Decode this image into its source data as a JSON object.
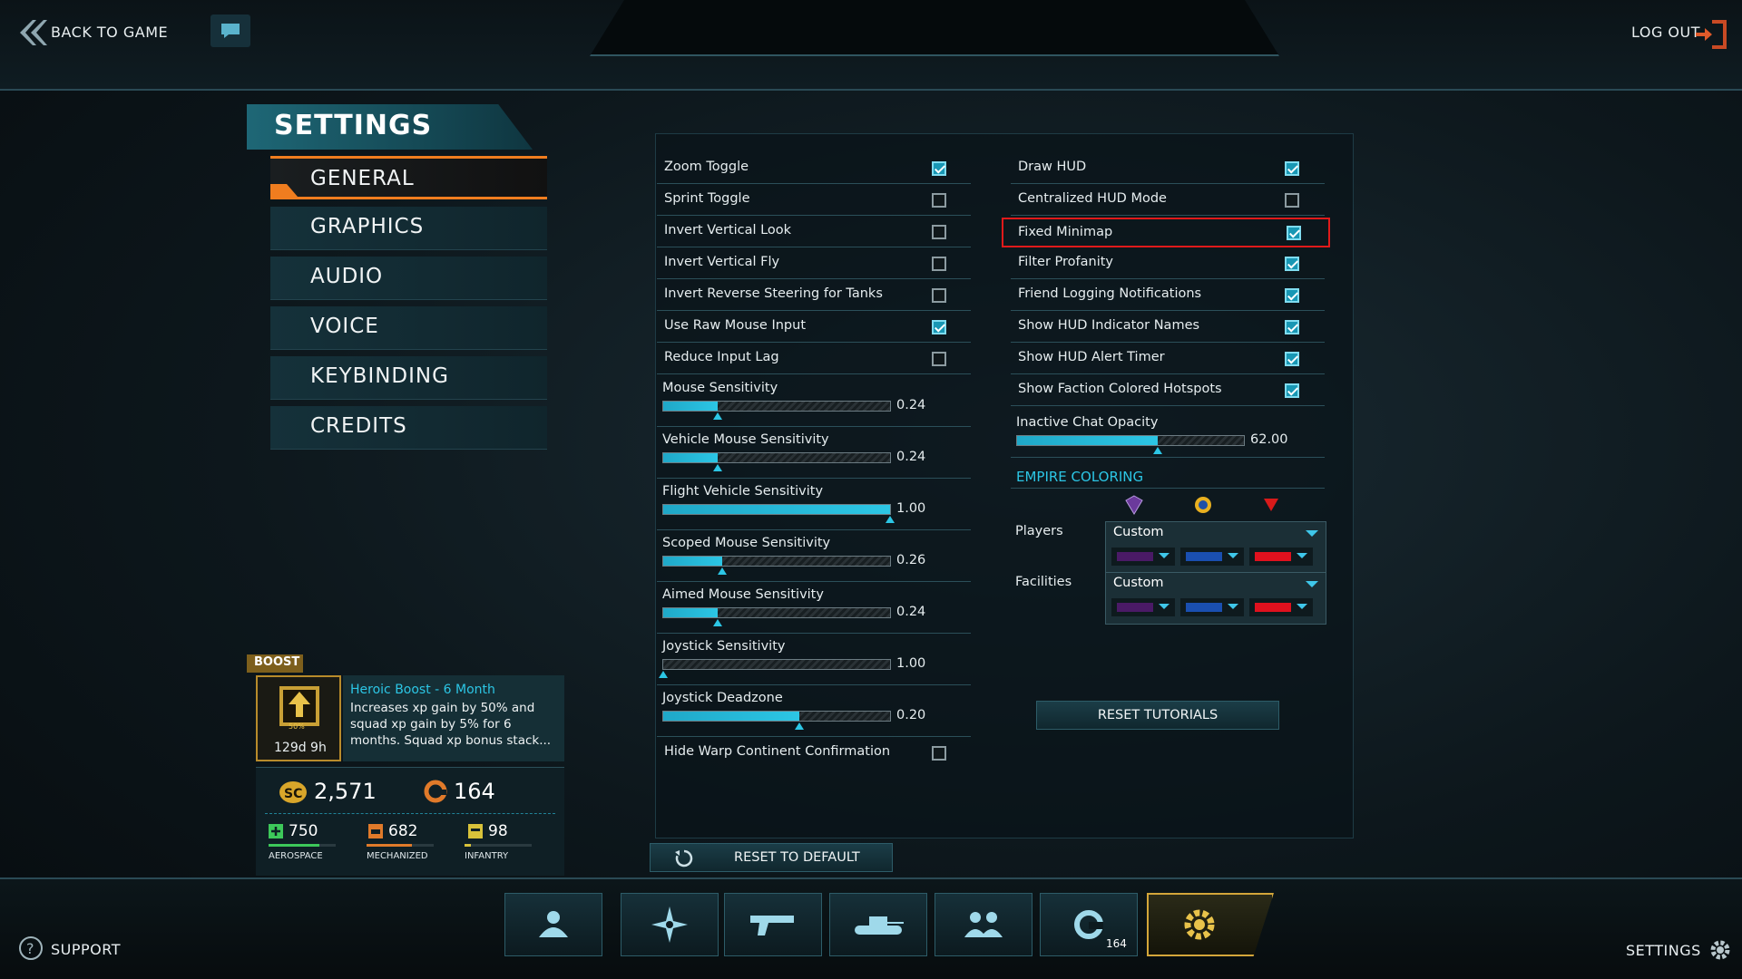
{
  "top": {
    "back_label": "BACK TO GAME",
    "logout_label": "LOG OUT"
  },
  "sidebar": {
    "title": "SETTINGS",
    "items": [
      {
        "label": "GENERAL",
        "active": true
      },
      {
        "label": "GRAPHICS"
      },
      {
        "label": "AUDIO"
      },
      {
        "label": "VOICE"
      },
      {
        "label": "KEYBINDING"
      },
      {
        "label": "CREDITS"
      }
    ]
  },
  "left_options": {
    "toggles": [
      {
        "label": "Zoom Toggle",
        "checked": true
      },
      {
        "label": "Sprint Toggle",
        "checked": false
      },
      {
        "label": "Invert Vertical Look",
        "checked": false
      },
      {
        "label": "Invert Vertical Fly",
        "checked": false
      },
      {
        "label": "Invert Reverse Steering for Tanks",
        "checked": false
      },
      {
        "label": "Use Raw Mouse Input",
        "checked": true
      },
      {
        "label": "Reduce Input Lag",
        "checked": false
      }
    ],
    "sliders": [
      {
        "label": "Mouse Sensitivity",
        "value": "0.24",
        "fill": 0.24
      },
      {
        "label": "Vehicle Mouse Sensitivity",
        "value": "0.24",
        "fill": 0.24
      },
      {
        "label": "Flight Vehicle Sensitivity",
        "value": "1.00",
        "fill": 1.0
      },
      {
        "label": "Scoped Mouse Sensitivity",
        "value": "0.26",
        "fill": 0.26
      },
      {
        "label": "Aimed Mouse Sensitivity",
        "value": "0.24",
        "fill": 0.24
      },
      {
        "label": "Joystick Sensitivity",
        "value": "1.00",
        "fill": 0.0
      },
      {
        "label": "Joystick Deadzone",
        "value": "0.20",
        "fill": 0.6
      }
    ],
    "last_toggle": {
      "label": "Hide Warp Continent Confirmation",
      "checked": false
    }
  },
  "right_options": {
    "toggles": [
      {
        "label": "Draw HUD",
        "checked": true
      },
      {
        "label": "Centralized HUD Mode",
        "checked": false
      },
      {
        "label": "Fixed Minimap",
        "checked": true,
        "highlighted": true
      },
      {
        "label": "Filter Profanity",
        "checked": true
      },
      {
        "label": "Friend Logging Notifications",
        "checked": true
      },
      {
        "label": "Show HUD Indicator Names",
        "checked": true
      },
      {
        "label": "Show HUD Alert Timer",
        "checked": true
      },
      {
        "label": "Show Faction Colored Hotspots",
        "checked": true
      }
    ],
    "chat_opacity": {
      "label": "Inactive Chat Opacity",
      "value": "62.00",
      "fill": 0.62
    },
    "empire_coloring": {
      "title": "EMPIRE COLORING",
      "faction_icons": [
        "vs-faction-icon",
        "nc-faction-icon",
        "tr-faction-icon"
      ],
      "rows": [
        {
          "label": "Players",
          "value": "Custom",
          "colors": [
            "#4a1a66",
            "#1a4fb0",
            "#e0111e"
          ]
        },
        {
          "label": "Facilities",
          "value": "Custom",
          "colors": [
            "#4a1a66",
            "#1a4fb0",
            "#e0111e"
          ]
        }
      ]
    },
    "reset_tutorials_label": "RESET TUTORIALS"
  },
  "reset_default_label": "RESET TO DEFAULT",
  "boost": {
    "tag": "BOOST",
    "badge_percent": "50%",
    "timer": "129d 9h",
    "title": "Heroic Boost - 6 Month",
    "description": "Increases xp gain by 50% and squad xp gain by 5% for 6 months.  Squad xp bonus stack..."
  },
  "currency": {
    "sc": "2,571",
    "certs": "164",
    "resources": [
      {
        "value": "750",
        "label": "AEROSPACE",
        "color": "#3dc85a",
        "fill": 0.75
      },
      {
        "value": "682",
        "label": "MECHANIZED",
        "color": "#e07a2a",
        "fill": 0.68
      },
      {
        "value": "98",
        "label": "INFANTRY",
        "color": "#d8c23a",
        "fill": 0.1
      }
    ]
  },
  "bottom": {
    "support_label": "SUPPORT",
    "settings_label": "SETTINGS",
    "tabs": [
      {
        "icon": "character-icon"
      },
      {
        "icon": "map-compass-icon"
      },
      {
        "icon": "weapon-icon"
      },
      {
        "icon": "vehicle-icon"
      },
      {
        "icon": "squad-icon"
      },
      {
        "icon": "certs-icon",
        "badge": "164"
      },
      {
        "icon": "settings-gear-icon",
        "active": true
      }
    ]
  },
  "colors": {
    "accent": "#2cc6e5",
    "active_orange": "#f07d1f",
    "highlight_red": "#e01a1a",
    "gold": "#d3a63a"
  }
}
